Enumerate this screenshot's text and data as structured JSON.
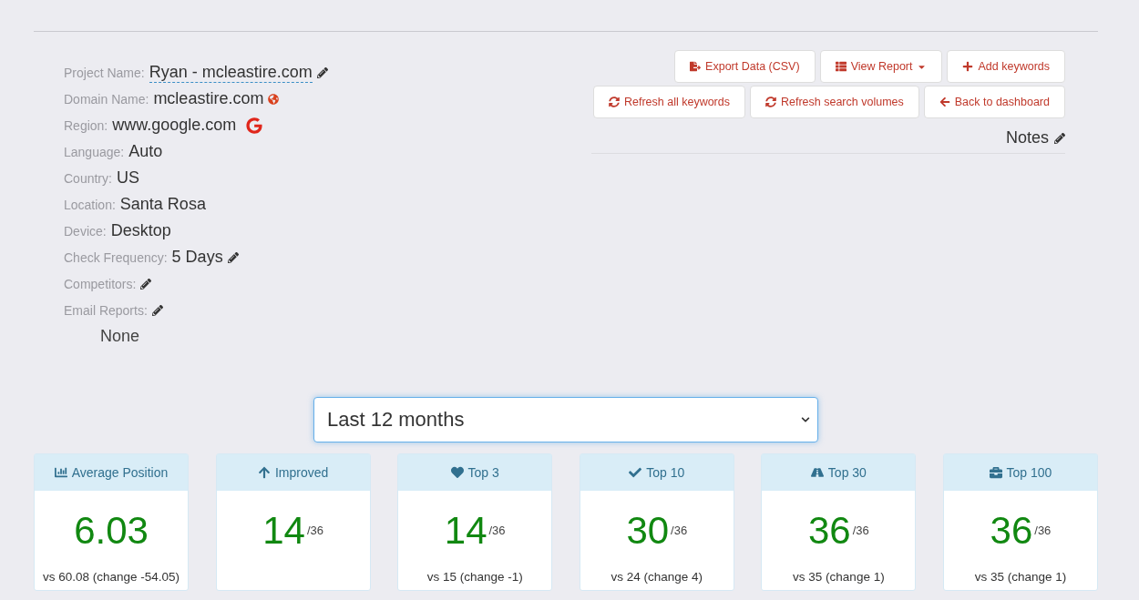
{
  "details": [
    {
      "label": "Project Name:",
      "value": "Ryan - mcleastire.com",
      "kind": "editable-link"
    },
    {
      "label": "Domain Name:",
      "value": "mcleastire.com",
      "kind": "globe"
    },
    {
      "label": "Region:",
      "value": "www.google.com",
      "kind": "google"
    },
    {
      "label": "Language:",
      "value": "Auto",
      "kind": "plain"
    },
    {
      "label": "Country:",
      "value": "US",
      "kind": "plain"
    },
    {
      "label": "Location:",
      "value": "Santa Rosa",
      "kind": "plain"
    },
    {
      "label": "Device:",
      "value": "Desktop",
      "kind": "plain"
    },
    {
      "label": "Check Frequency:",
      "value": "5 Days",
      "kind": "edit"
    },
    {
      "label": "Competitors:",
      "kind": "edit"
    },
    {
      "label": "Email Reports:",
      "kind": "edit"
    }
  ],
  "email_reports_value": "None",
  "actions": [
    [
      {
        "label": "Export Data (CSV)",
        "kind": "export"
      },
      {
        "label": "View Report",
        "kind": "report-menu"
      },
      {
        "label": "Add keywords",
        "kind": "add"
      }
    ],
    [
      {
        "label": "Refresh all keywords",
        "kind": "refresh"
      },
      {
        "label": "Refresh search volumes",
        "kind": "refresh"
      },
      {
        "label": "Back to dashboard",
        "kind": "back"
      }
    ]
  ],
  "notes": "Notes",
  "period_select": {
    "value": "Last 12 months"
  },
  "cards": [
    {
      "kind": "chart",
      "title": "Average Position",
      "value": "6.03",
      "comparison": "vs 60.08 (change -54.05)"
    },
    {
      "kind": "up",
      "title": "Improved",
      "value": "14",
      "total": "/36"
    },
    {
      "kind": "heart",
      "title": "Top 3",
      "value": "14",
      "total": "/36",
      "comparison": "vs 15 (change -1)"
    },
    {
      "kind": "check",
      "title": "Top 10",
      "value": "30",
      "total": "/36",
      "comparison": "vs 24 (change 4)"
    },
    {
      "kind": "road",
      "title": "Top 30",
      "value": "36",
      "total": "/36",
      "comparison": "vs 35 (change 1)"
    },
    {
      "kind": "briefcase",
      "title": "Top 100",
      "value": "36",
      "total": "/36",
      "comparison": "vs 35 (change 1)"
    }
  ]
}
